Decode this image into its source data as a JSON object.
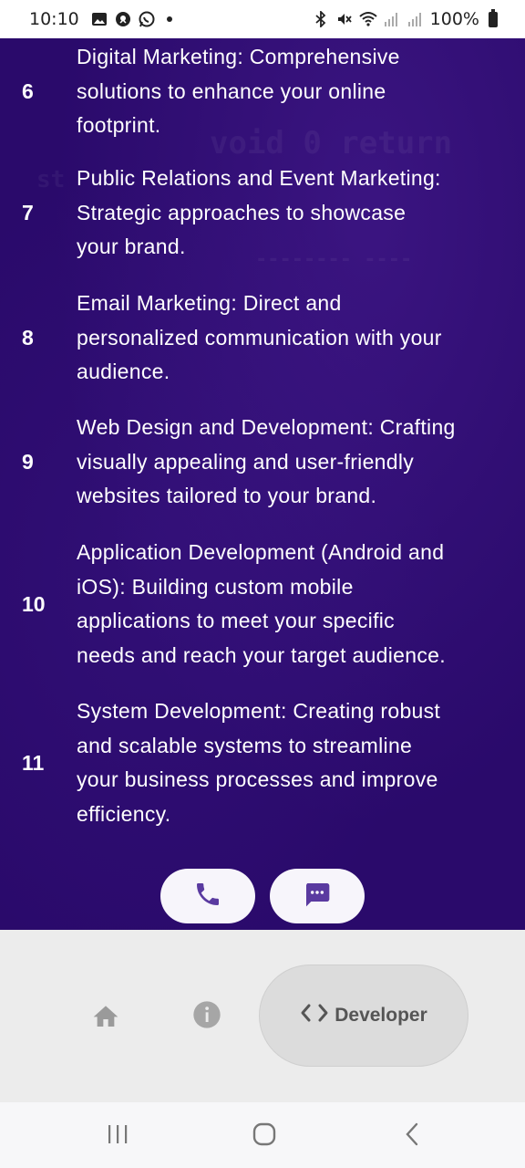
{
  "status_bar": {
    "time": "10:10",
    "battery": "100%",
    "icons_left": [
      "image-icon",
      "messenger-icon",
      "whatsapp-icon"
    ],
    "icons_right": [
      "bluetooth-icon",
      "mute-icon",
      "wifi-icon",
      "signal-icon",
      "signal-icon",
      "battery-icon"
    ]
  },
  "services": [
    {
      "number": "6",
      "lines": [
        "Digital Marketing: Comprehensive",
        "solutions to enhance your online",
        "footprint."
      ]
    },
    {
      "number": "7",
      "lines": [
        "Public Relations and Event Marketing:",
        "Strategic approaches to showcase",
        "your brand."
      ]
    },
    {
      "number": "8",
      "lines": [
        "Email Marketing: Direct and",
        "personalized communication with your",
        "audience."
      ]
    },
    {
      "number": "9",
      "lines": [
        "Web Design and Development: Crafting",
        "visually appealing and user-friendly",
        "websites tailored to your brand."
      ]
    },
    {
      "number": "10",
      "lines": [
        "Application Development (Android and",
        "iOS): Building custom mobile",
        "applications to meet your specific",
        "needs and reach your target audience."
      ]
    },
    {
      "number": "11",
      "lines": [
        "System Development: Creating robust",
        "and scalable systems to streamline",
        "your business processes and improve",
        "efficiency."
      ]
    }
  ],
  "actions": {
    "call_icon": "phone-icon",
    "message_icon": "chat-icon"
  },
  "bottom_nav": {
    "items": [
      {
        "icon": "home-icon"
      },
      {
        "icon": "info-icon"
      },
      {
        "icon": "code-icon",
        "label": "Developer",
        "selected": true
      }
    ]
  },
  "colors": {
    "background": "#2a0a6b",
    "accent": "#5a3aa0",
    "text": "#ffffff",
    "nav_bg": "#ececec"
  }
}
